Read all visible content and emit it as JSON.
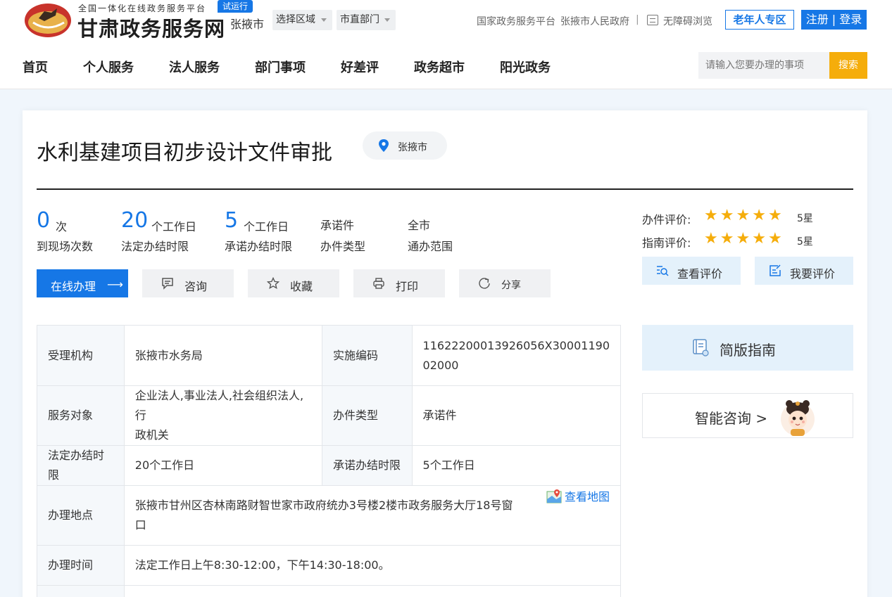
{
  "header": {
    "site_subtitle": "全国一体化在线政务服务平台",
    "site_title": "甘肃政务服务网",
    "trial_badge": "试运行",
    "city": "张掖市",
    "region_select": "选择区域",
    "dept_select": "市直部门",
    "link_national": "国家政务服务平台",
    "link_gov": "张掖市人民政府",
    "separator": "|",
    "accessibility": "无障碍浏览",
    "elder_zone": "老年人专区",
    "login": "注册 | 登录"
  },
  "nav": {
    "items": [
      "首页",
      "个人服务",
      "法人服务",
      "部门事项",
      "好差评",
      "政务超市",
      "阳光政务"
    ],
    "search_placeholder": "请输入您要办理的事项",
    "search_button": "搜索"
  },
  "item": {
    "title": "水利基建项目初步设计文件审批",
    "location": "张掖市"
  },
  "stats": {
    "visits_num": "0",
    "visits_unit": "次",
    "visits_label": "到现场次数",
    "legal_num": "20",
    "legal_unit": "个工作日",
    "legal_label": "法定办结时限",
    "promise_num": "5",
    "promise_unit": "个工作日",
    "promise_label": "承诺办结时限",
    "type_val": "承诺件",
    "type_label": "办件类型",
    "scope_val": "全市",
    "scope_label": "通办范围"
  },
  "actions": {
    "online": "在线办理",
    "online_arrow": "⟶",
    "consult": "咨询",
    "favorite": "收藏",
    "print": "打印",
    "share": "分享"
  },
  "ratings": {
    "handle_label": "办件评价:",
    "handle_stars": 5,
    "handle_score": "5星",
    "guide_label": "指南评价:",
    "guide_stars": 5,
    "guide_score": "5星",
    "view_button": "查看评价",
    "rate_button": "我要评价"
  },
  "table": {
    "k_agency": "受理机构",
    "v_agency": "张掖市水务局",
    "k_code": "实施编码",
    "v_code_1": "11622200013926056X30001190",
    "v_code_2": "02000",
    "k_target": "服务对象",
    "v_target_1": "企业法人,事业法人,社会组织法人,行",
    "v_target_2": "政机关",
    "k_type": "办件类型",
    "v_type": "承诺件",
    "k_legal": "法定办结时限",
    "v_legal": "20个工作日",
    "k_promise": "承诺办结时限",
    "v_promise": "5个工作日",
    "k_place": "办理地点",
    "v_place_1": "张掖市甘州区杏林南路财智世家市政府统办3号楼2楼市政务服务大厅18号窗",
    "v_place_2": "口",
    "map_link": "查看地图",
    "k_time": "办理时间",
    "v_time": "法定工作日上午8:30-12:00，下午14:30-18:00。"
  },
  "side": {
    "guide": "简版指南",
    "ai": "智能咨询 >"
  },
  "colors": {
    "primary": "#1677e6",
    "accent": "#f5ad0b",
    "light_blue": "#e4f1fb"
  }
}
